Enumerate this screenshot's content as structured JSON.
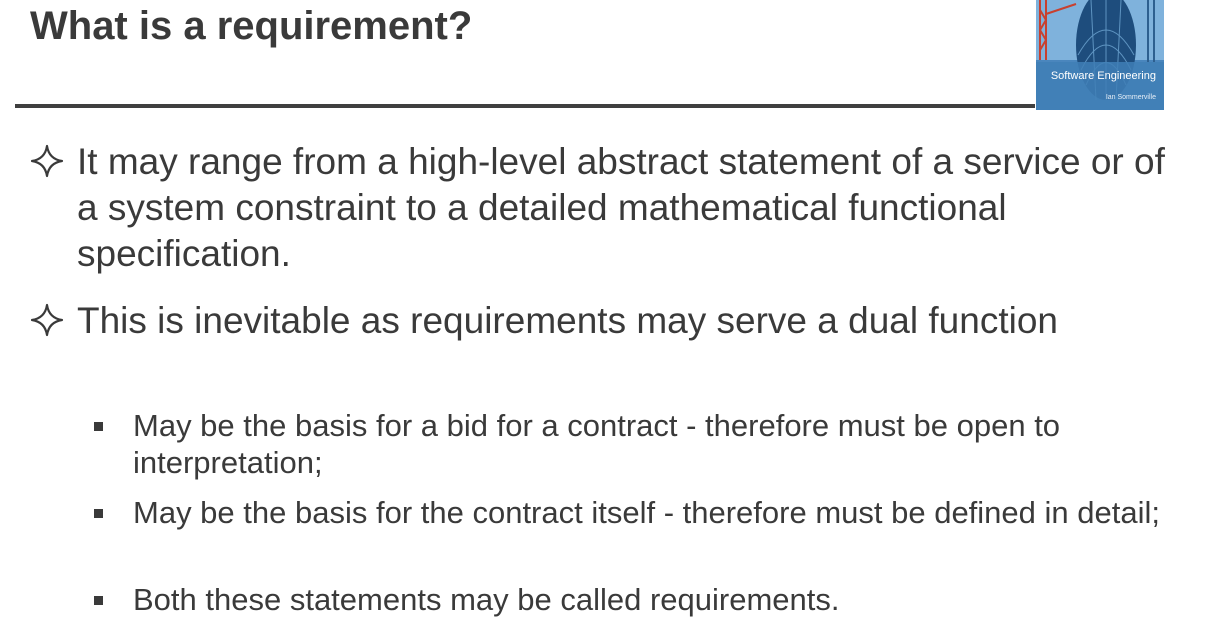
{
  "slide": {
    "title": "What is a requirement?"
  },
  "book_cover": {
    "title": "Software Engineering",
    "author": "Ian Sommerville",
    "icon": "book-cover-image"
  },
  "bullets": [
    {
      "level": 1,
      "marker": "four-point-star-outline-icon",
      "text": "It may range from a high-level abstract statement of a service or of a system constraint to a detailed mathematical functional specification."
    },
    {
      "level": 1,
      "marker": "four-point-star-outline-icon",
      "text": "This is inevitable as requirements may serve a dual function"
    },
    {
      "level": 2,
      "marker": "square-bullet-icon",
      "text": "May be the basis for a bid for a contract - therefore must be open to interpretation;"
    },
    {
      "level": 2,
      "marker": "square-bullet-icon",
      "text": "May be the basis for the contract itself - therefore must be defined in detail;"
    },
    {
      "level": 2,
      "marker": "square-bullet-icon",
      "text": "Both these statements may be called requirements."
    }
  ],
  "colors": {
    "text": "#3a3a3a",
    "rule": "#3f3f3f",
    "background": "#ffffff"
  }
}
